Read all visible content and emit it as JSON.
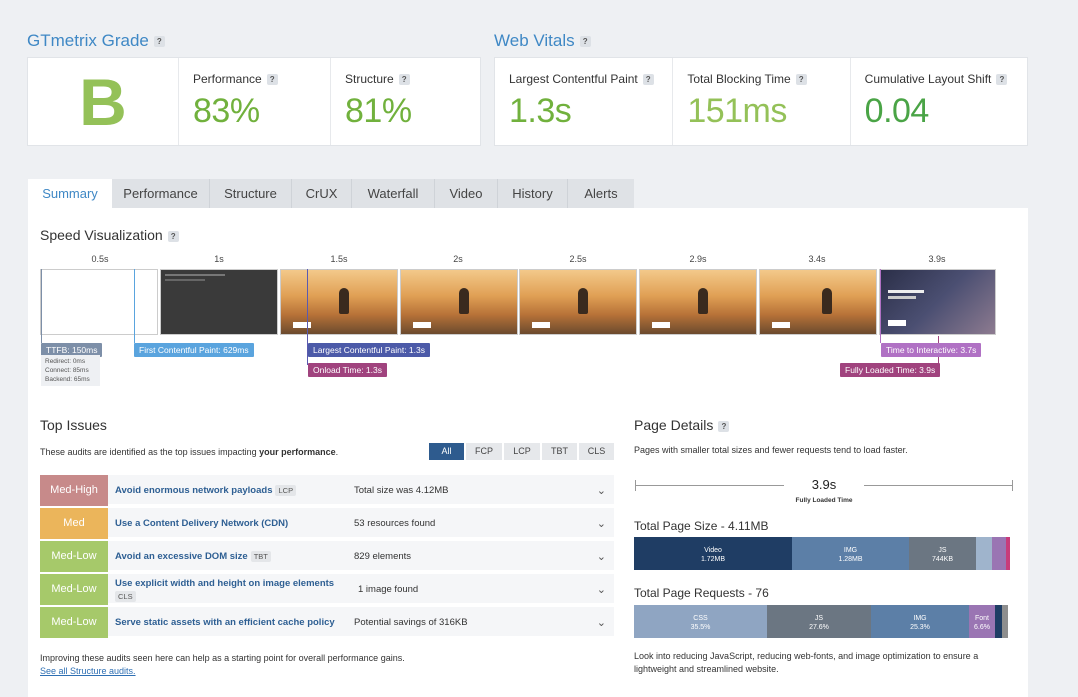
{
  "grade": {
    "title": "GTmetrix Grade",
    "help": "?",
    "letter": "B",
    "performance": {
      "label": "Performance",
      "value": "83%"
    },
    "structure": {
      "label": "Structure",
      "value": "81%"
    }
  },
  "vitals": {
    "title": "Web Vitals",
    "help": "?",
    "lcp": {
      "label": "Largest Contentful Paint",
      "value": "1.3s"
    },
    "tbt": {
      "label": "Total Blocking Time",
      "value": "151ms"
    },
    "cls": {
      "label": "Cumulative Layout Shift",
      "value": "0.04"
    }
  },
  "tabs": [
    "Summary",
    "Performance",
    "Structure",
    "CrUX",
    "Waterfall",
    "Video",
    "History",
    "Alerts"
  ],
  "speed": {
    "title": "Speed Visualization",
    "ticks": [
      "0.5s",
      "1s",
      "1.5s",
      "2s",
      "2.5s",
      "2.9s",
      "3.4s",
      "3.9s"
    ],
    "ttfb": "TTFB: 150ms",
    "ttfb_details": [
      "Redirect: 0ms",
      "Connect: 85ms",
      "Backend: 65ms"
    ],
    "fcp": "First Contentful Paint: 629ms",
    "lcp": "Largest Contentful Paint: 1.3s",
    "onload": "Onload Time: 1.3s",
    "tti": "Time to Interactive: 3.7s",
    "fully_loaded": "Fully Loaded Time: 3.9s"
  },
  "top_issues": {
    "title": "Top Issues",
    "desc_prefix": "These audits are identified as the top issues impacting ",
    "desc_bold": "your performance",
    "desc_suffix": ".",
    "filters": [
      "All",
      "FCP",
      "LCP",
      "TBT",
      "CLS"
    ],
    "rows": [
      {
        "severity": "Med-High",
        "color": "#c78a8a",
        "name": "Avoid enormous network payloads",
        "tag": "LCP",
        "value": "Total size was 4.12MB"
      },
      {
        "severity": "Med",
        "color": "#ebb55b",
        "name": "Use a Content Delivery Network (CDN)",
        "tag": "",
        "value": "53 resources found"
      },
      {
        "severity": "Med-Low",
        "color": "#a6c96a",
        "name": "Avoid an excessive DOM size",
        "tag": "TBT",
        "value": "829 elements"
      },
      {
        "severity": "Med-Low",
        "color": "#a6c96a",
        "name": "Use explicit width and height on image elements",
        "tag": "CLS",
        "value": "1 image found"
      },
      {
        "severity": "Med-Low",
        "color": "#a6c96a",
        "name": "Serve static assets with an efficient cache policy",
        "tag": "",
        "value": "Potential savings of 316KB"
      }
    ],
    "footer": "Improving these audits seen here can help as a starting point for overall performance gains.",
    "link": "See all Structure audits."
  },
  "page_details": {
    "title": "Page Details",
    "desc": "Pages with smaller total sizes and fewer requests tend to load faster.",
    "fully_loaded_value": "3.9s",
    "fully_loaded_label": "Fully Loaded Time",
    "size_title": "Total Page Size - 4.11MB",
    "size_segments": [
      {
        "label": "Video",
        "value": "1.72MB",
        "color": "#1f3d64"
      },
      {
        "label": "IMG",
        "value": "1.28MB",
        "color": "#5c7fa7"
      },
      {
        "label": "JS",
        "value": "744KB",
        "color": "#6b7682"
      },
      {
        "label": "",
        "value": "",
        "color": "#9fb4cc"
      },
      {
        "label": "",
        "value": "",
        "color": "#9a75b3"
      },
      {
        "label": "",
        "value": "",
        "color": "#c83b7a"
      }
    ],
    "requests_title": "Total Page Requests - 76",
    "request_segments": [
      {
        "label": "CSS",
        "value": "35.5%",
        "color": "#8fa5c2"
      },
      {
        "label": "JS",
        "value": "27.6%",
        "color": "#6b7682"
      },
      {
        "label": "IMG",
        "value": "25.3%",
        "color": "#5c7fa7"
      },
      {
        "label": "Font",
        "value": "6.6%",
        "color": "#9a75b3"
      },
      {
        "label": "",
        "value": "",
        "color": "#1f3d64"
      },
      {
        "label": "",
        "value": "",
        "color": "#8e8e8e"
      }
    ],
    "footer": "Look into reducing JavaScript, reducing web-fonts, and image optimization to ensure a lightweight and streamlined website."
  }
}
